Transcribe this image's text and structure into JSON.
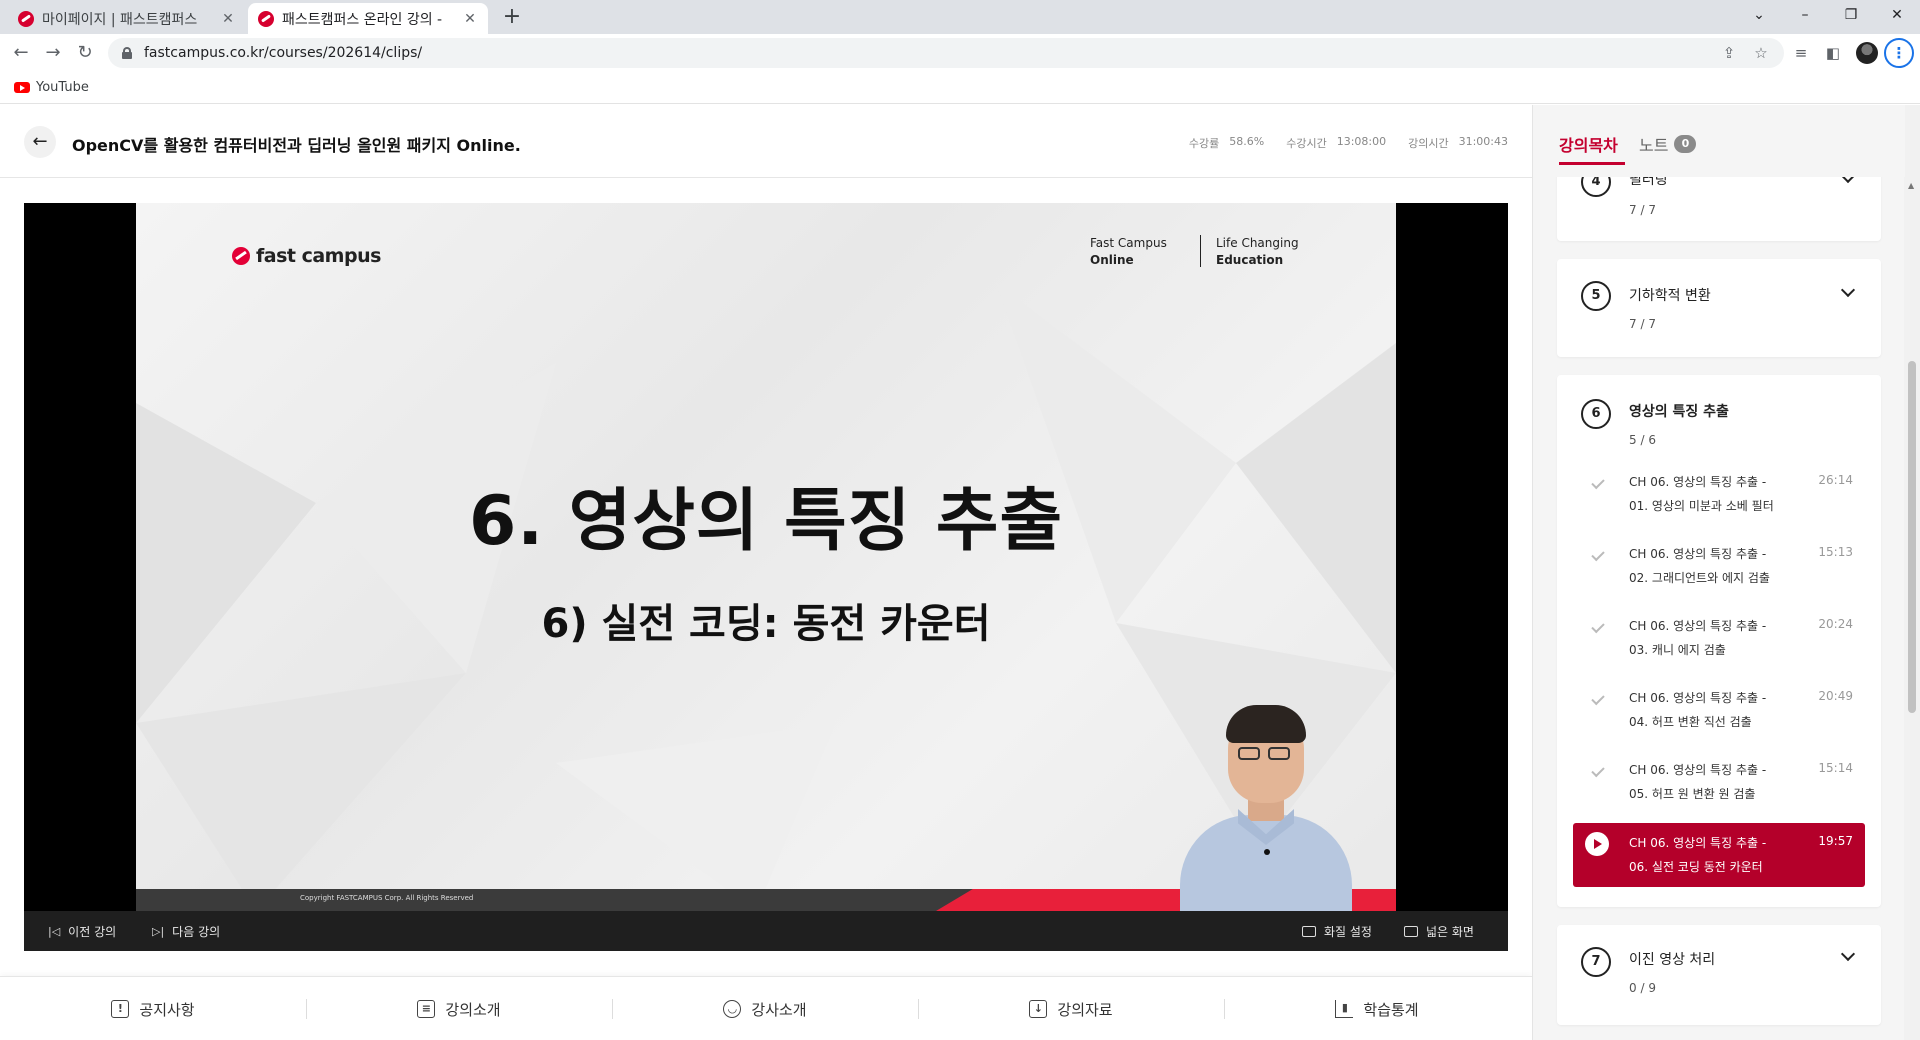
{
  "browser": {
    "tabs": [
      {
        "title": "마이페이지 | 패스트캠퍼스",
        "active": false
      },
      {
        "title": "패스트캠퍼스 온라인 강의 -",
        "active": true
      }
    ],
    "url": "fastcampus.co.kr/courses/202614/clips/",
    "bookmarks": [
      {
        "label": "YouTube"
      }
    ]
  },
  "header": {
    "course_title": "OpenCV를 활용한 컴퓨터비전과 딥러닝 올인원 패키지 Online.",
    "stats": [
      {
        "label": "수강률",
        "value": "58.6%"
      },
      {
        "label": "수강시간",
        "value": "13:08:00"
      },
      {
        "label": "강의시간",
        "value": "31:00:43"
      }
    ]
  },
  "video": {
    "logo_text": "fast campus",
    "tagline_left": [
      "Fast Campus",
      "Online"
    ],
    "tagline_right": [
      "Life Changing",
      "Education"
    ],
    "slide_title": "6. 영상의 특징 추출",
    "slide_subtitle": "6) 실전 코딩: 동전 카운터",
    "copyright": "Copyright FASTCAMPUS Corp. All Rights Reserved",
    "controls": {
      "prev": "이전 강의",
      "next": "다음 강의",
      "quality": "화질 설정",
      "wide": "넓은 화면"
    }
  },
  "bottom_tabs": [
    {
      "label": "공지사항",
      "icon": "notice-icon"
    },
    {
      "label": "강의소개",
      "icon": "course-intro-icon"
    },
    {
      "label": "강사소개",
      "icon": "instructor-icon"
    },
    {
      "label": "강의자료",
      "icon": "materials-icon"
    },
    {
      "label": "학습통계",
      "icon": "stats-icon"
    }
  ],
  "sidebar": {
    "tab_toc": "강의목차",
    "tab_note": "노트",
    "note_count": "0",
    "chapters": [
      {
        "num": "4",
        "title": "필터링",
        "progress_done": "7",
        "progress_sep": "/",
        "progress_total": "7"
      },
      {
        "num": "5",
        "title": "기하학적 변환",
        "progress_done": "7",
        "progress_sep": "/",
        "progress_total": "7"
      },
      {
        "num": "6",
        "title": "영상의 특징 추출",
        "progress_done": "5",
        "progress_sep": "/",
        "progress_total": "6",
        "lessons": [
          {
            "line1": "CH 06. 영상의 특징 추출 -",
            "line2": "01. 영상의 미분과 소베 필터",
            "time": "26:14"
          },
          {
            "line1": "CH 06. 영상의 특징 추출 -",
            "line2": "02. 그래디언트와 에지 검출",
            "time": "15:13"
          },
          {
            "line1": "CH 06. 영상의 특징 추출 -",
            "line2": "03. 캐니 에지 검출",
            "time": "20:24"
          },
          {
            "line1": "CH 06. 영상의 특징 추출 -",
            "line2": "04. 허프 변환 직선 검출",
            "time": "20:49"
          },
          {
            "line1": "CH 06. 영상의 특징 추출 -",
            "line2": "05. 허프 원 변환 원 검출",
            "time": "15:14"
          },
          {
            "line1": "CH 06. 영상의 특징 추출 -",
            "line2": "06. 실전 코딩 동전 카운터",
            "time": "19:57"
          }
        ]
      },
      {
        "num": "7",
        "title": "이진 영상 처리",
        "progress_done": "0",
        "progress_sep": "/",
        "progress_total": "9"
      }
    ]
  }
}
